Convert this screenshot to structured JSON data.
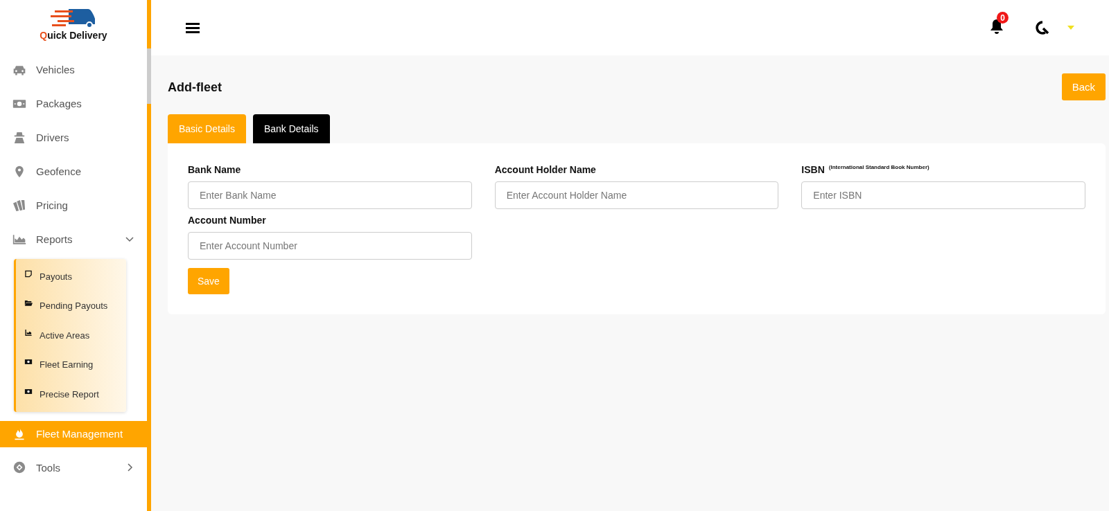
{
  "brand": {
    "name_first": "Q",
    "name_rest": "uick Delivery"
  },
  "sidebar": {
    "items": [
      {
        "label": "Vehicles",
        "selected": false
      },
      {
        "label": "Packages",
        "selected": false
      },
      {
        "label": "Drivers",
        "selected": false
      },
      {
        "label": "Geofence",
        "selected": false
      },
      {
        "label": "Pricing",
        "selected": false
      },
      {
        "label": "Reports",
        "selected": false,
        "expanded": true,
        "children": [
          {
            "label": "Payouts",
            "selected": false
          },
          {
            "label": "Pending Payouts",
            "selected": false
          },
          {
            "label": "Active Areas",
            "selected": false
          },
          {
            "label": "Fleet Earning",
            "selected": false
          },
          {
            "label": "Precise Report",
            "selected": false
          }
        ]
      },
      {
        "label": "Fleet Management",
        "selected": true
      },
      {
        "label": "Tools",
        "selected": false,
        "expanded": false
      }
    ]
  },
  "header": {
    "notification_count": "0"
  },
  "page": {
    "title": "Add-fleet",
    "back_button": "Back"
  },
  "tabs": [
    {
      "label": "Basic Details",
      "selected": false
    },
    {
      "label": "Bank Details",
      "selected": true
    }
  ],
  "form": {
    "fields": [
      {
        "label": "Bank Name",
        "placeholder": "Enter Bank Name"
      },
      {
        "label": "Account Holder Name",
        "placeholder": "Enter Account Holder Name"
      },
      {
        "label": "ISBN",
        "note": "(International Standard Book Number)",
        "placeholder": "Enter ISBN"
      },
      {
        "label": "Account Number",
        "placeholder": "Enter Account Number"
      }
    ],
    "save_button": "Save"
  }
}
